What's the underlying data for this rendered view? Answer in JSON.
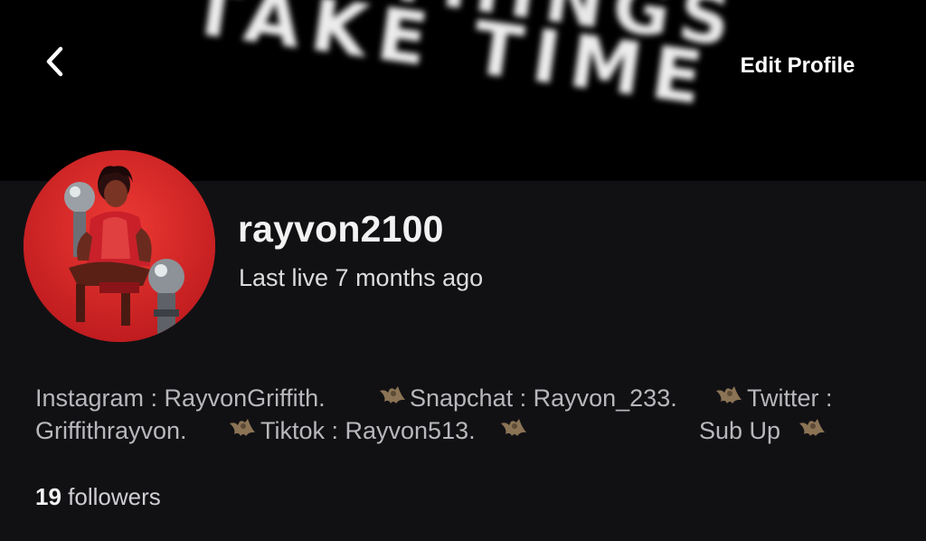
{
  "banner": {
    "text_line1": "GOOD THINGS",
    "text_line2": "TAKE TIME",
    "background": "#000000"
  },
  "header": {
    "back_icon": "chevron-left-icon",
    "edit_profile_label": "Edit Profile"
  },
  "profile": {
    "username": "rayvon2100",
    "last_live": "Last live 7 months ago",
    "avatar_icon": "avatar-photo",
    "avatar_color": "#d8262a"
  },
  "bio": {
    "line1": {
      "instagram": "Instagram : RayvonGriffith.",
      "snapchat": "Snapchat : Rayvon_233.",
      "twitter": "Twitter :"
    },
    "line2": {
      "twitter_handle": "Griffithrayvon.",
      "tiktok": "Tiktok : Rayvon513.",
      "sub_up": "Sub Up"
    },
    "emoji_icon": "bat-icon"
  },
  "stats": {
    "followers_count": "19",
    "followers_label": "followers"
  }
}
